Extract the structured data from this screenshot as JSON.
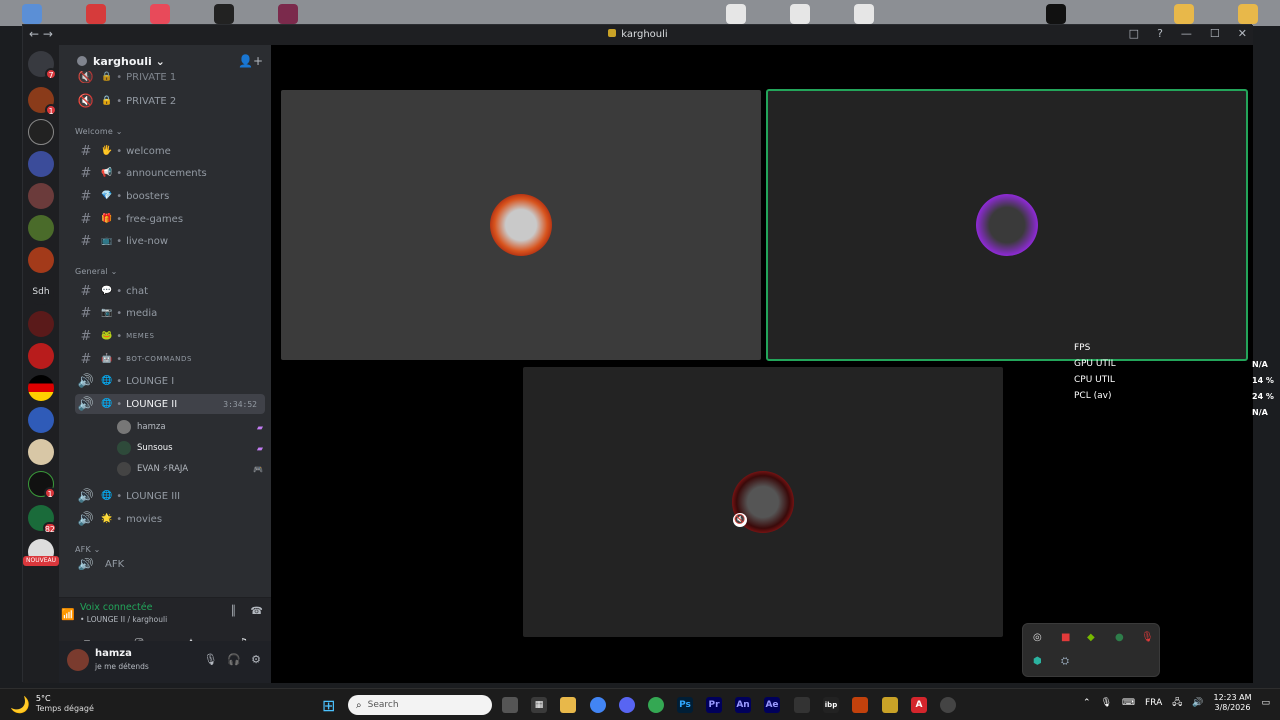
{
  "window": {
    "title": "karghouli",
    "controls": [
      "□",
      "?",
      "—",
      "☐",
      "✕"
    ]
  },
  "guild_badges": [
    "7",
    "1",
    "1",
    "82"
  ],
  "guild_labels": {
    "sdh": "Sdh",
    "nouveau": "NOUVEAU"
  },
  "server": {
    "name": "karghouli ⌄"
  },
  "channels": [
    {
      "type": "locked",
      "name": "PRIVATE 1"
    },
    {
      "type": "locked",
      "name": "PRIVATE 2"
    },
    {
      "type": "category",
      "name": "Welcome ⌄"
    },
    {
      "type": "text",
      "emoji": "🖐",
      "name": "welcome"
    },
    {
      "type": "text",
      "emoji": "📢",
      "name": "announcements"
    },
    {
      "type": "text",
      "emoji": "💎",
      "name": "boosters"
    },
    {
      "type": "text",
      "emoji": "🎁",
      "name": "free-games"
    },
    {
      "type": "text",
      "emoji": "📺",
      "name": "live-now"
    },
    {
      "type": "category",
      "name": "General ⌄"
    },
    {
      "type": "text",
      "emoji": "💬",
      "name": "chat"
    },
    {
      "type": "text",
      "emoji": "📷",
      "name": "media"
    },
    {
      "type": "text",
      "emoji": "🐸",
      "name": "MEMES"
    },
    {
      "type": "text",
      "emoji": "🤖",
      "name": "BOT-COMMANDS"
    },
    {
      "type": "voice",
      "emoji": "🌐",
      "name": "LOUNGE I"
    },
    {
      "type": "voice",
      "emoji": "🌐",
      "name": "LOUNGE II",
      "time": "3:34:52"
    },
    {
      "type": "voice",
      "emoji": "🌐",
      "name": "LOUNGE III"
    },
    {
      "type": "voice",
      "emoji": "🌟",
      "name": "movies"
    },
    {
      "type": "category",
      "name": "AFK ⌄"
    },
    {
      "type": "voice",
      "emoji": "",
      "name": "AFK"
    }
  ],
  "voice_users": [
    {
      "name": "hamza"
    },
    {
      "name": "Sunsous"
    },
    {
      "name": "EVAN  ⚡RAJA"
    }
  ],
  "voice_panel": {
    "status": "Voix connectée",
    "sub": "• LOUNGE II / karghouli"
  },
  "user": {
    "name": "hamza",
    "status": "je me détends"
  },
  "overlay": {
    "labels": [
      "FPS",
      "GPU UTIL",
      "CPU UTIL",
      "PCL (av)"
    ],
    "values": [
      "N/A",
      "14 %",
      "24 %",
      "N/A"
    ]
  },
  "taskbar": {
    "weather_temp": "5°C",
    "weather_desc": "Temps dégagé",
    "search_placeholder": "Search",
    "lang": "FRA",
    "time": "12:23 AM",
    "date": "3/8/2026"
  },
  "colors": {
    "speaking": "#23a55a",
    "accent": "#5865f2"
  }
}
